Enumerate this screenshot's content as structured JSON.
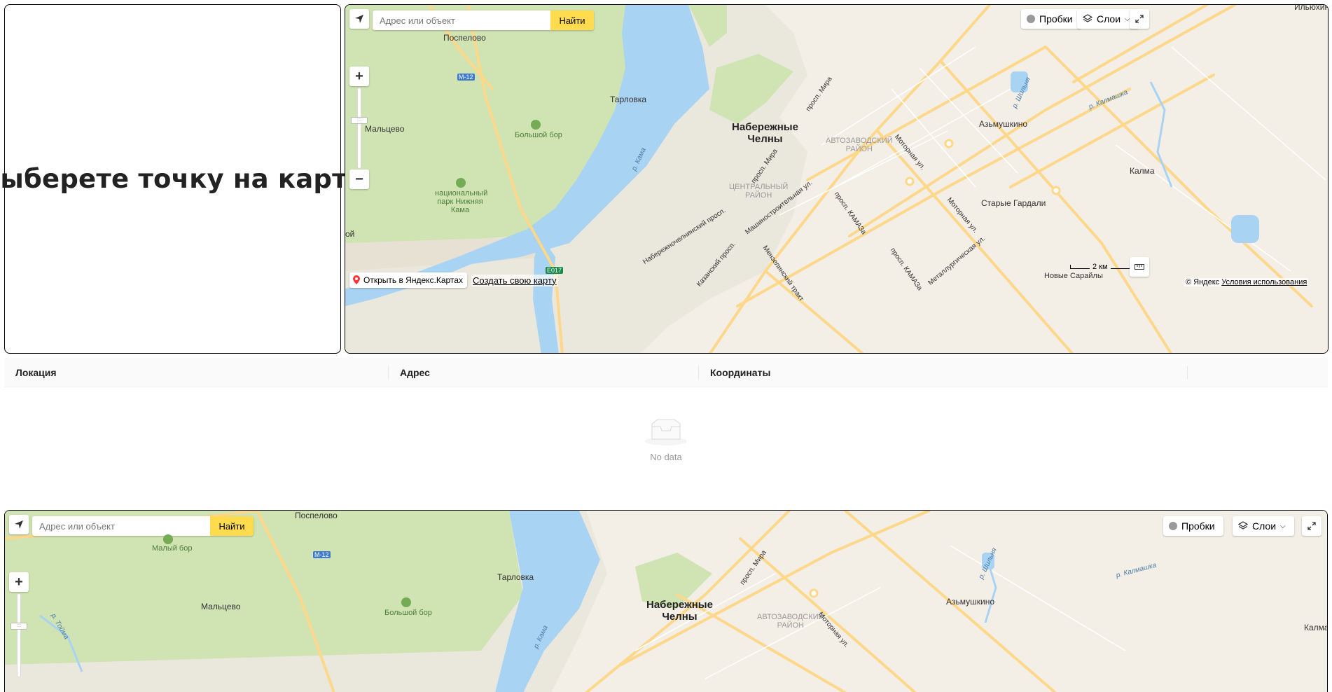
{
  "prompt": {
    "heading": "Выберете точку на карте"
  },
  "map_controls": {
    "search_placeholder": "Адрес или объект",
    "search_button": "Найти",
    "traffic_label": "Пробки",
    "layers_label": "Слои",
    "open_in_yandex": "Открыть в Яндекс.Картах",
    "create_map": "Создать свою карту",
    "scale_label": "2 км",
    "copyright_brand": "© Яндекс",
    "terms_link": "Условия использования"
  },
  "map_labels": {
    "poselovo": "Поспелово",
    "ilyukhino": "Ильюхино",
    "m12": "M-12",
    "tarlovka": "Тарловка",
    "maltsevo": "Мальцево",
    "bolshoy_bor": "Большой бор",
    "maly_bor": "Малый бор",
    "park_1": "национальный",
    "park_2": "парк Нижняя",
    "park_3": "Кама",
    "kama": "р. Кама",
    "city_1": "Набережные",
    "city_2": "Челны",
    "avtozavod_1": "АВТОЗАВОДСКИЙ",
    "avtozavod_2": "РАЙОН",
    "central_1": "ЦЕНТРАЛЬНЫЙ",
    "central_2": "РАЙОН",
    "prosp_mira": "просп. Мира",
    "motornaya": "Моторная ул.",
    "kamaza": "просп. КАМАЗа",
    "mashinostr": "Машиностроительная ул.",
    "naberezhnochelninsky": "Набережночелнинский просп.",
    "kazansky": "Казанский просп.",
    "menzelinsky": "Мензелинский тракт",
    "metallurg": "Металлургическая ул.",
    "azmushkino": "Азьмушкино",
    "starye_gardali": "Старые Гардали",
    "novye_saraily": "Новые Сарайлы",
    "kalmashka": "р. Калмашка",
    "shilnya": "р. Шильня",
    "kalm_short": "Калма",
    "e017": "E017",
    "oy": "ой",
    "toyma": "р. Тойма"
  },
  "table": {
    "columns": [
      "Локация",
      "Адрес",
      "Координаты"
    ],
    "empty_text": "No data"
  },
  "colors": {
    "search_button_bg": "#ffdb4d",
    "water": "#a9d3f2",
    "forest": "#cfe3b3",
    "city": "#f3efe6",
    "road": "#fdd78a"
  }
}
